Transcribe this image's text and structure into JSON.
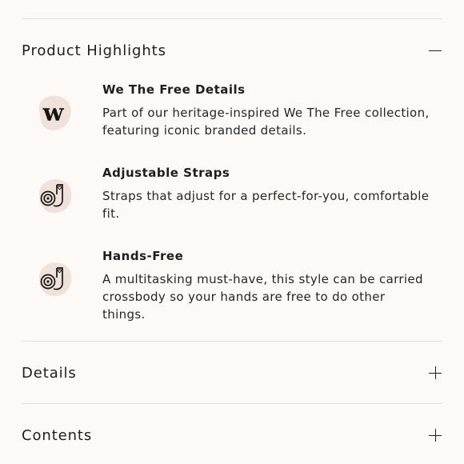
{
  "sections": {
    "highlights": {
      "title": "Product Highlights",
      "state": "expanded",
      "toggle_icon": "minus-icon"
    },
    "details": {
      "title": "Details",
      "state": "collapsed",
      "toggle_icon": "plus-icon"
    },
    "contents": {
      "title": "Contents",
      "state": "collapsed",
      "toggle_icon": "plus-icon"
    }
  },
  "highlights": [
    {
      "icon": "we-the-free-logo-icon",
      "title": "We The Free Details",
      "body": "Part of our heritage-inspired We The Free collection, featuring iconic branded details."
    },
    {
      "icon": "adjustable-strap-icon",
      "title": "Adjustable Straps",
      "body": "Straps that adjust for a perfect-for-you, comfortable fit."
    },
    {
      "icon": "hands-free-strap-icon",
      "title": "Hands-Free",
      "body": "A multitasking must-have, this style can be carried crossbody so your hands are free to do other things."
    }
  ],
  "colors": {
    "background": "#fdf9f7",
    "badge_blob": "#f0e2da",
    "divider": "#e4dfdc",
    "text": "#1e1e1e"
  }
}
